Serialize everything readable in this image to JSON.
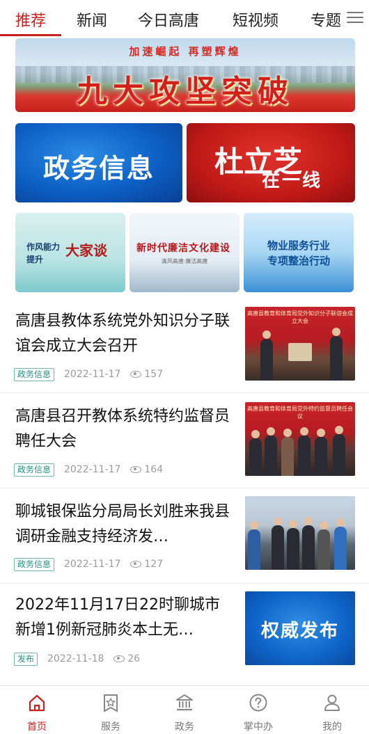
{
  "top_tabs": [
    {
      "label": "推荐",
      "active": true
    },
    {
      "label": "新闻",
      "active": false
    },
    {
      "label": "今日高唐",
      "active": false
    },
    {
      "label": "短视频",
      "active": false
    },
    {
      "label": "专题",
      "active": false
    }
  ],
  "banner": {
    "slogan": "加速崛起 再塑辉煌",
    "headline": "九大攻坚突破"
  },
  "cards": {
    "left": "政务信息",
    "right_line1": "杜立芝",
    "right_line2": "在一线"
  },
  "small_cards": [
    {
      "line_a": "作风能力\n提升",
      "line_b": "大家谈"
    },
    {
      "line_a": "新时代廉洁文化建设",
      "line_b": "清风高唐·廉洁高唐"
    },
    {
      "line_a": "物业服务行业\n专项整治行动"
    }
  ],
  "news": [
    {
      "title": "高唐县教体系统党外知识分子联谊会成立大会召开",
      "tag": "政务信息",
      "date": "2022-11-17",
      "views": "157",
      "thumb_caption": "高唐县教育和体育局党外知识分子联谊会成立大会"
    },
    {
      "title": "高唐县召开教体系统特约监督员聘任大会",
      "tag": "政务信息",
      "date": "2022-11-17",
      "views": "164",
      "thumb_caption": "高唐县教育和体育局党外特约监督员聘任会议"
    },
    {
      "title": "聊城银保监分局局长刘胜来我县调研金融支持经济发…",
      "tag": "政务信息",
      "date": "2022-11-17",
      "views": "127",
      "thumb_caption": ""
    },
    {
      "title": "2022年11月17日22时聊城市新增1例新冠肺炎本土无…",
      "tag": "发布",
      "date": "2022-11-18",
      "views": "26",
      "thumb_caption": "权威发布"
    }
  ],
  "bottom_nav": [
    {
      "label": "首页",
      "icon": "home-icon",
      "active": true
    },
    {
      "label": "服务",
      "icon": "star-bookmark-icon",
      "active": false
    },
    {
      "label": "政务",
      "icon": "government-building-icon",
      "active": false
    },
    {
      "label": "掌中办",
      "icon": "question-circle-icon",
      "active": false
    },
    {
      "label": "我的",
      "icon": "user-icon",
      "active": false
    }
  ],
  "colors": {
    "accent": "#c8201d",
    "tag_text": "#2a8f86",
    "meta_gray": "#9a9a9a"
  }
}
